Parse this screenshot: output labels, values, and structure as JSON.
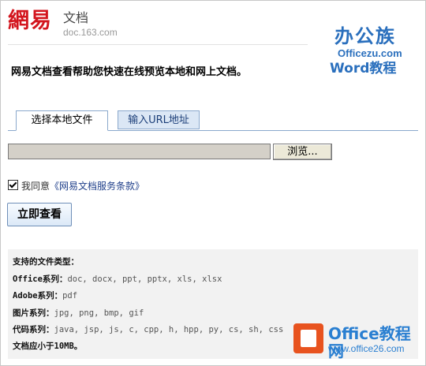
{
  "header": {
    "logo_main": "網易",
    "logo_title": "文档",
    "logo_domain": "doc.163.com"
  },
  "watermark_top": {
    "brand": "办公族",
    "site": "Officezu.com",
    "tagline": "Word教程"
  },
  "intro_text": "网易文档查看帮助您快速在线预览本地和网上文档。",
  "tabs": [
    {
      "label": "选择本地文件",
      "active": true
    },
    {
      "label": "输入URL地址",
      "active": false
    }
  ],
  "file_input": {
    "value": ""
  },
  "browse_label": "浏览...",
  "agreement": {
    "checked": true,
    "prefix": "我同意",
    "link": "《网易文档服务条款》"
  },
  "view_button": "立即查看",
  "info": {
    "title": "支持的文件类型：",
    "rows": [
      {
        "label": "Office系列：",
        "value": "doc, docx, ppt, pptx, xls, xlsx"
      },
      {
        "label": "Adobe系列：",
        "value": "pdf"
      },
      {
        "label": "图片系列：",
        "value": "jpg, png, bmp, gif"
      },
      {
        "label": "代码系列：",
        "value": "java, jsp, js, c, cpp, h, hpp, py, cs, sh, css"
      }
    ],
    "size_note": "文档应小于10MB。"
  },
  "watermark_bottom": {
    "brand": "Office教程网",
    "site": "www.office26.com"
  },
  "colors": {
    "logo_red": "#d3151e",
    "link_blue": "#1f3f8a",
    "tab_blue": "#dbe7f5",
    "watermark_blue": "#2a7fd1",
    "office_orange": "#e8531f"
  }
}
